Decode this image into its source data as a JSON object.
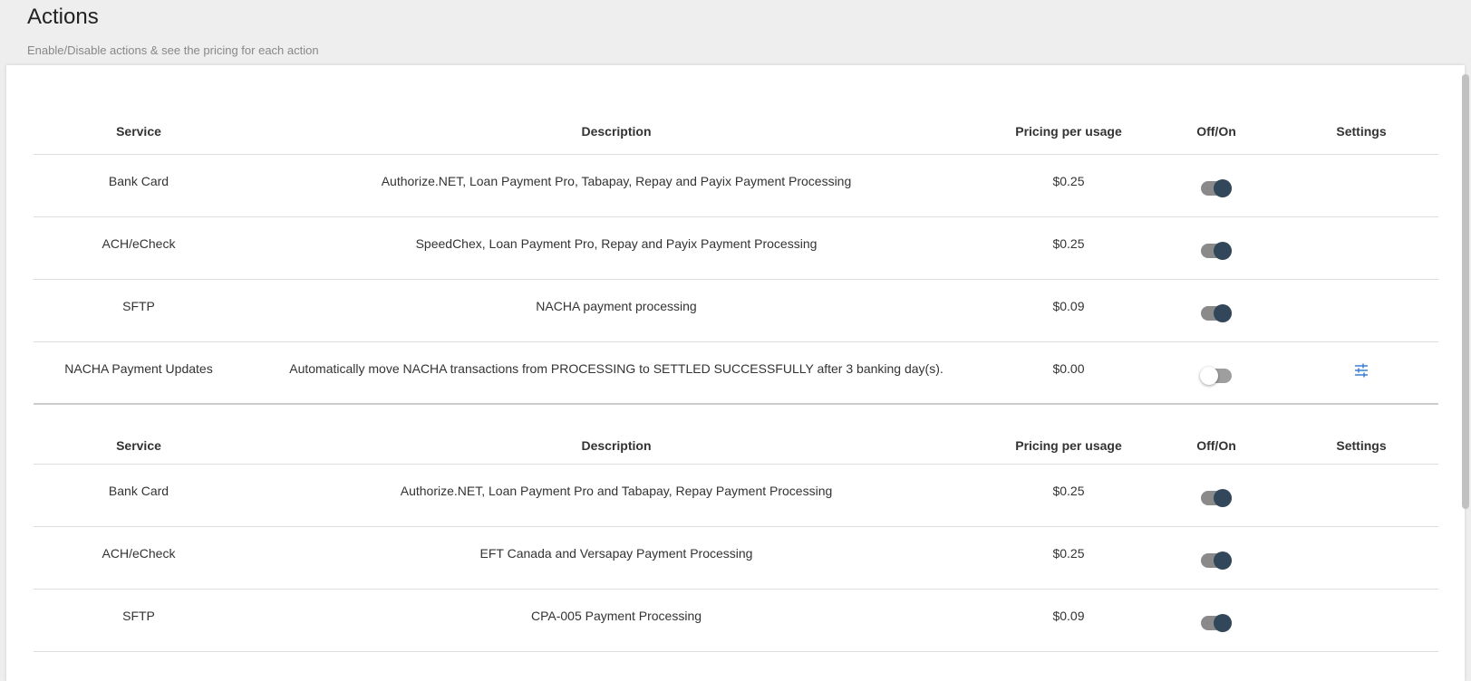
{
  "header": {
    "title": "Actions",
    "subtitle": "Enable/Disable actions & see the pricing for each action"
  },
  "columns": {
    "service": "Service",
    "description": "Description",
    "pricing": "Pricing per usage",
    "toggle": "Off/On",
    "settings": "Settings"
  },
  "table1": {
    "rows": [
      {
        "service": "Bank Card",
        "description": "Authorize.NET, Loan Payment Pro, Tabapay, Repay and Payix Payment Processing",
        "price": "$0.25",
        "enabled": true,
        "has_settings": false
      },
      {
        "service": "ACH/eCheck",
        "description": "SpeedChex, Loan Payment Pro, Repay and Payix Payment Processing",
        "price": "$0.25",
        "enabled": true,
        "has_settings": false
      },
      {
        "service": "SFTP",
        "description": "NACHA payment processing",
        "price": "$0.09",
        "enabled": true,
        "has_settings": false
      },
      {
        "service": "NACHA Payment Updates",
        "description": "Automatically move NACHA transactions from PROCESSING to SETTLED SUCCESSFULLY after 3 banking day(s).",
        "price": "$0.00",
        "enabled": false,
        "has_settings": true
      }
    ]
  },
  "table2": {
    "rows": [
      {
        "service": "Bank Card",
        "description": "Authorize.NET, Loan Payment Pro and Tabapay, Repay Payment Processing",
        "price": "$0.25",
        "enabled": true,
        "has_settings": false
      },
      {
        "service": "ACH/eCheck",
        "description": "EFT Canada and Versapay Payment Processing",
        "price": "$0.25",
        "enabled": true,
        "has_settings": false
      },
      {
        "service": "SFTP",
        "description": "CPA-005 Payment Processing",
        "price": "$0.09",
        "enabled": true,
        "has_settings": false
      }
    ]
  },
  "icons": {
    "settings": "sliders-icon",
    "settings_color": "#3b7dd8"
  }
}
